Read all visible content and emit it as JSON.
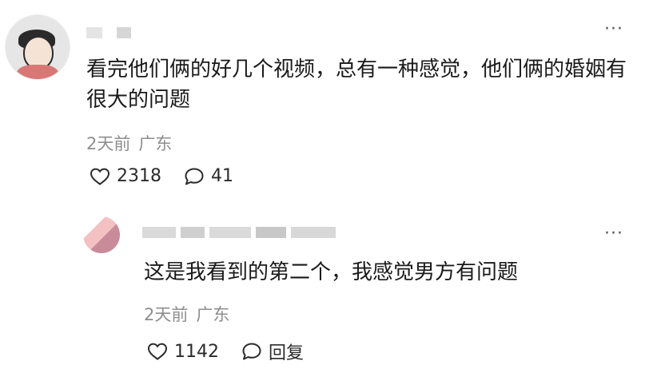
{
  "comment": {
    "text": "看完他们俩的好几个视频，总有一种感觉，他们俩的婚姻有很大的问题",
    "meta": {
      "time": "2天前",
      "location": "广东"
    },
    "likes": "2318",
    "replies": "41",
    "more_icon": "more-horizontal-icon"
  },
  "reply": {
    "text": "这是我看到的第二个，我感觉男方有问题",
    "meta": {
      "time": "2天前",
      "location": "广东"
    },
    "likes": "1142",
    "reply_label": "回复",
    "more_icon": "more-horizontal-icon"
  },
  "icons": {
    "like": "heart-outline-icon",
    "comment": "comment-bubble-icon"
  },
  "colors": {
    "text": "#1a1a1a",
    "meta": "#8e8e8e",
    "icon": "#2b2b2b"
  }
}
